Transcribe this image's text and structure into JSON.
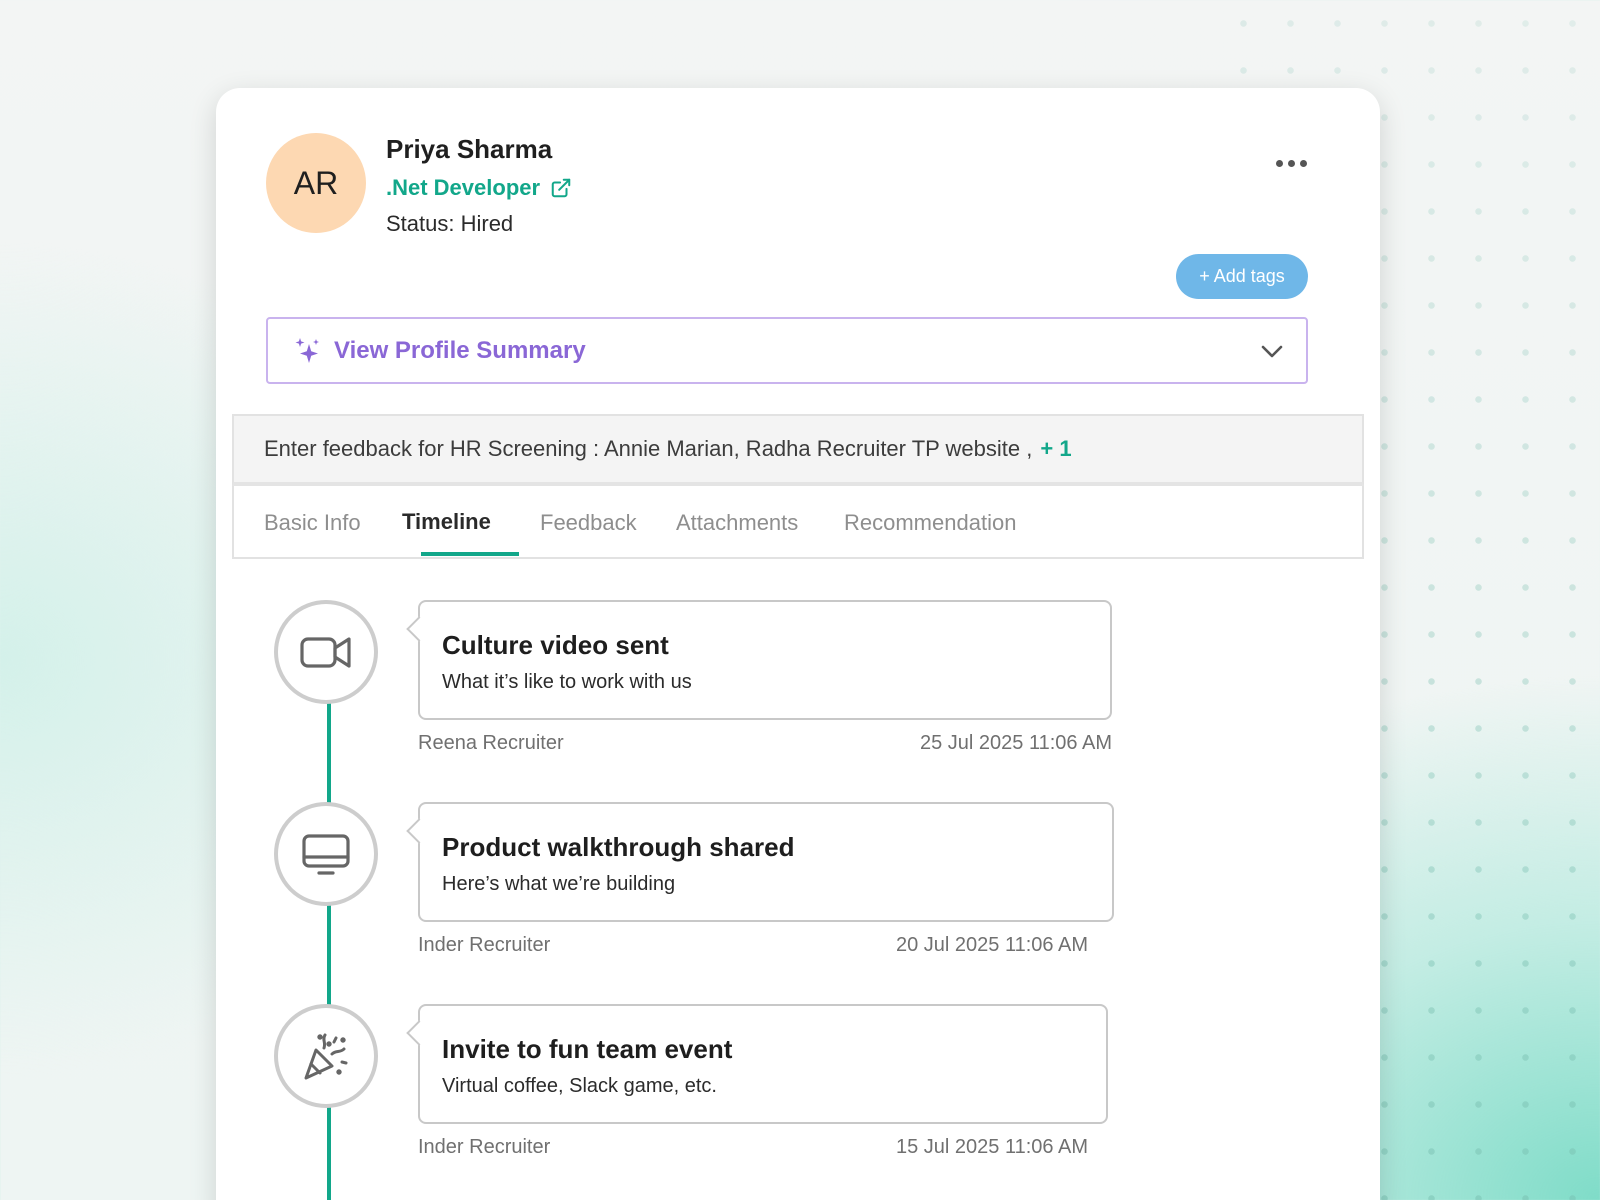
{
  "candidate": {
    "initials": "AR",
    "name": "Priya Sharma",
    "role": ".Net Developer",
    "status": "Status: Hired"
  },
  "actions": {
    "add_tags_label": "+ Add tags",
    "more_icon": "more-horizontal-icon"
  },
  "profile_summary": {
    "label": "View Profile Summary",
    "icon": "sparkle-icon"
  },
  "feedback_prompt": {
    "text": "Enter feedback for HR Screening : Annie Marian, Radha Recruiter TP website ,",
    "extra": "+ 1"
  },
  "tabs": [
    {
      "label": "Basic Info",
      "active": false
    },
    {
      "label": "Timeline",
      "active": true
    },
    {
      "label": "Feedback",
      "active": false
    },
    {
      "label": "Attachments",
      "active": false
    },
    {
      "label": "Recommendation",
      "active": false
    }
  ],
  "timeline": [
    {
      "icon": "video-camera-icon",
      "title": "Culture video sent",
      "subtitle": "What it’s like to work with us",
      "author": "Reena Recruiter",
      "date": "25 Jul 2025 11:06 AM"
    },
    {
      "icon": "monitor-icon",
      "title": "Product walkthrough shared",
      "subtitle": "Here’s what we’re building",
      "author": "Inder Recruiter",
      "date": "20 Jul 2025 11:06 AM"
    },
    {
      "icon": "party-popper-icon",
      "title": "Invite to fun team event",
      "subtitle": "Virtual coffee, Slack game, etc.",
      "author": "Inder Recruiter",
      "date": "15 Jul 2025 11:06 AM"
    }
  ],
  "colors": {
    "accent": "#12a78a",
    "summary_purple": "#8a67d6",
    "tag_blue": "#6fb7e8",
    "avatar_bg": "#fdd8b2"
  }
}
